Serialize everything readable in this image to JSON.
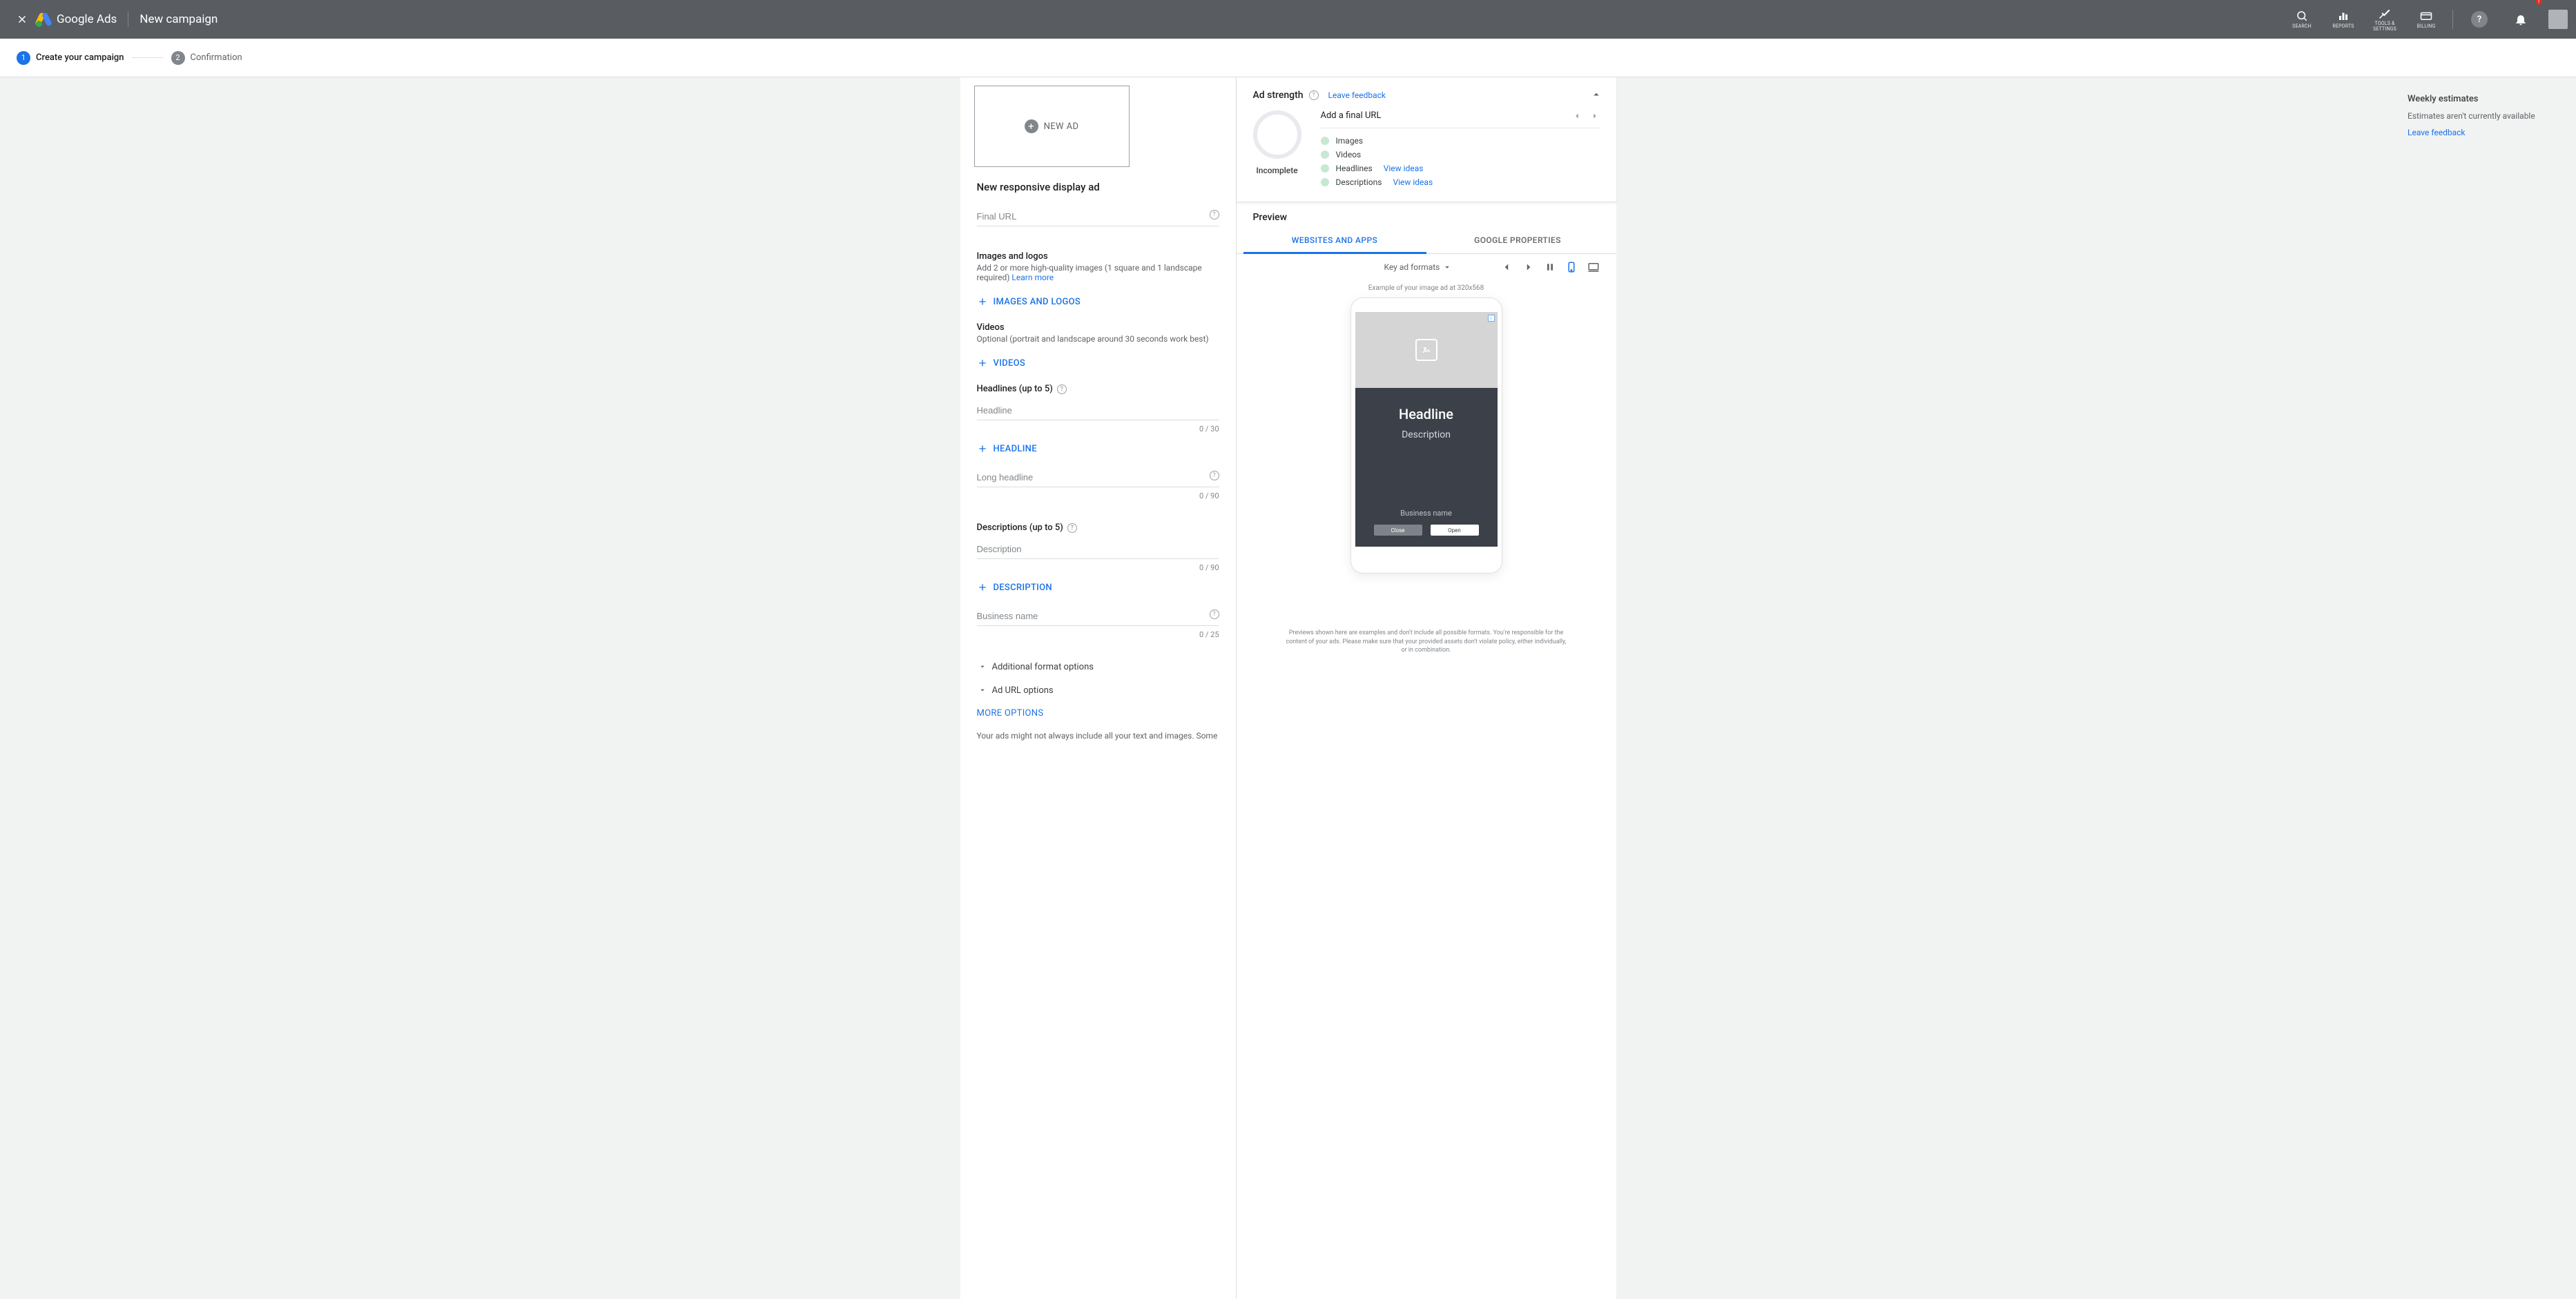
{
  "topbar": {
    "brand": "Google Ads",
    "title": "New campaign",
    "search": "SEARCH",
    "reports": "REPORTS",
    "tools": "TOOLS & SETTINGS",
    "billing": "BILLING"
  },
  "stepper": {
    "step1_num": "1",
    "step1_label": "Create your campaign",
    "step2_num": "2",
    "step2_label": "Confirmation"
  },
  "newad_label": "NEW AD",
  "form": {
    "title": "New responsive display ad",
    "final_url_ph": "Final URL",
    "images_title": "Images and logos",
    "images_sub": "Add 2 or more high-quality images (1 square and 1 landscape required) ",
    "learn_more": "Learn more",
    "images_btn": "IMAGES AND LOGOS",
    "videos_title": "Videos",
    "videos_sub": "Optional (portrait and landscape around 30 seconds work best)",
    "videos_btn": "VIDEOS",
    "headlines_title": "Headlines (up to 5)",
    "headline_ph": "Headline",
    "headline_counter": "0 / 30",
    "headline_btn": "HEADLINE",
    "long_headline_ph": "Long headline",
    "long_headline_counter": "0 / 90",
    "desc_title": "Descriptions (up to 5)",
    "desc_ph": "Description",
    "desc_counter": "0 / 90",
    "desc_btn": "DESCRIPTION",
    "biz_ph": "Business name",
    "biz_counter": "0 / 25",
    "expand1": "Additional format options",
    "expand2": "Ad URL options",
    "more": "MORE OPTIONS",
    "disclaimer": "Your ads might not always include all your text and images. Some"
  },
  "strength": {
    "title": "Ad strength",
    "leave_feedback": "Leave feedback",
    "gauge_label": "Incomplete",
    "top_msg": "Add a final URL",
    "c1": "Images",
    "c2": "Videos",
    "c3": "Headlines",
    "c4": "Descriptions",
    "view_ideas": "View ideas"
  },
  "preview": {
    "label": "Preview",
    "tab1": "WEBSITES AND APPS",
    "tab2": "GOOGLE PROPERTIES",
    "dd": "Key ad formats",
    "mock_label": "Example of your image ad at 320x568",
    "ad_headline": "Headline",
    "ad_desc": "Description",
    "ad_biz": "Business name",
    "ad_close": "Close",
    "ad_open": "Open",
    "disclaimer": "Previews shown here are examples and don't include all possible formats. You're responsible for the content of your ads. Please make sure that your provided assets don't violate policy, either individually, or in combination."
  },
  "right": {
    "title": "Weekly estimates",
    "msg": "Estimates aren't currently available",
    "link": "Leave feedback"
  }
}
